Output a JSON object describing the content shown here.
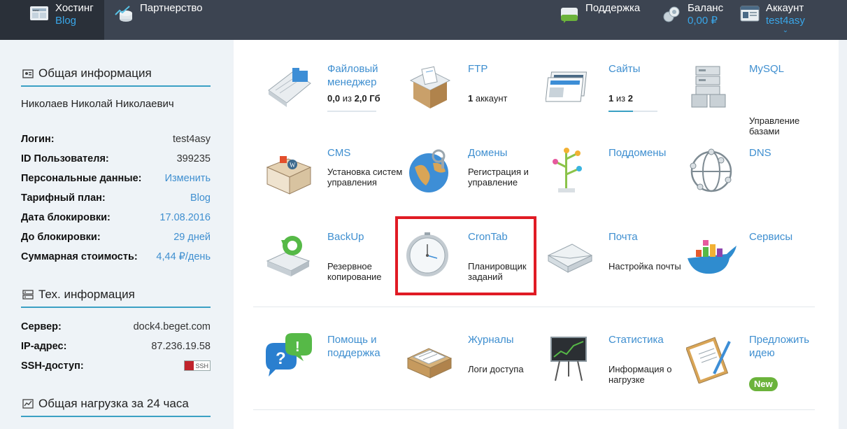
{
  "topbar": {
    "hosting": {
      "title": "Хостинг",
      "sub": "Blog"
    },
    "partners": {
      "title": "Партнерство"
    },
    "support": {
      "title": "Поддержка"
    },
    "balance": {
      "title": "Баланс",
      "sub": "0,00 ₽"
    },
    "account": {
      "title": "Аккаунт",
      "sub": "test4asy",
      "chevron": "⌄"
    }
  },
  "sidebar": {
    "general": {
      "title": "Общая информация",
      "icon": "id-card-icon",
      "full_name": "Николаев Николай Николаевич",
      "rows": [
        {
          "label": "Логин:",
          "value": "test4asy"
        },
        {
          "label": "ID Пользователя:",
          "value": "399235"
        },
        {
          "label": "Персональные данные:",
          "value": "Изменить"
        },
        {
          "label": "Тарифный план:",
          "value": "Blog"
        },
        {
          "label": "Дата блокировки:",
          "value": "17.08.2016"
        },
        {
          "label": "До блокировки:",
          "value": "29 дней"
        },
        {
          "label": "Суммарная стоимость:",
          "value": "4,44 ₽/день"
        }
      ]
    },
    "tech": {
      "title": "Тех. информация",
      "icon": "server-icon",
      "rows": [
        {
          "label": "Сервер:",
          "value": "dock4.beget.com"
        },
        {
          "label": "IP-адрес:",
          "value": "87.236.19.58"
        },
        {
          "label": "SSH-доступ:",
          "value": "SSH"
        }
      ]
    },
    "load": {
      "title": "Общая нагрузка за 24 часа",
      "icon": "chart-icon"
    }
  },
  "tiles": [
    {
      "name": "Файловый менеджер",
      "desc_num": "0,0",
      "desc_mid": "из",
      "desc_num2": "2,0 Гб",
      "usage": 0,
      "icon": "file-manager-icon"
    },
    {
      "name": "FTP",
      "desc_num": "1",
      "desc_mid": "аккаунт",
      "icon": "ftp-icon"
    },
    {
      "name": "Сайты",
      "desc_num": "1",
      "desc_mid": "из",
      "desc_num2": "2",
      "usage": 0.5,
      "icon": "sites-icon"
    },
    {
      "name": "MySQL",
      "desc": "Управление базами",
      "icon": "mysql-icon"
    },
    {
      "name": "CMS",
      "desc": "Установка систем управления",
      "icon": "cms-icon"
    },
    {
      "name": "Домены",
      "desc": "Регистрация и управление",
      "icon": "domains-icon"
    },
    {
      "name": "Поддомены",
      "icon": "subdomains-icon"
    },
    {
      "name": "DNS",
      "icon": "dns-icon"
    },
    {
      "name": "BackUp",
      "desc": "Резервное копирование",
      "icon": "backup-icon"
    },
    {
      "name": "CronTab",
      "desc": "Планировщик заданий",
      "icon": "crontab-clock-icon"
    },
    {
      "name": "Почта",
      "desc": "Настройка почты",
      "icon": "mail-icon"
    },
    {
      "name": "Сервисы",
      "icon": "services-whale-icon"
    },
    {
      "name": "Помощь и поддержка",
      "icon": "help-icon"
    },
    {
      "name": "Журналы",
      "desc": "Логи доступа",
      "icon": "logs-icon"
    },
    {
      "name": "Статистика",
      "desc": "Информация о нагрузке",
      "icon": "statistics-icon"
    },
    {
      "name": "Предложить идею",
      "badge": "New",
      "icon": "idea-icon"
    }
  ],
  "colors": {
    "accent": "#3aa0c4",
    "link": "#3f8fd0",
    "topbar": "#3c4451",
    "highlight": "#e01b24",
    "new_badge": "#6bb33b"
  }
}
